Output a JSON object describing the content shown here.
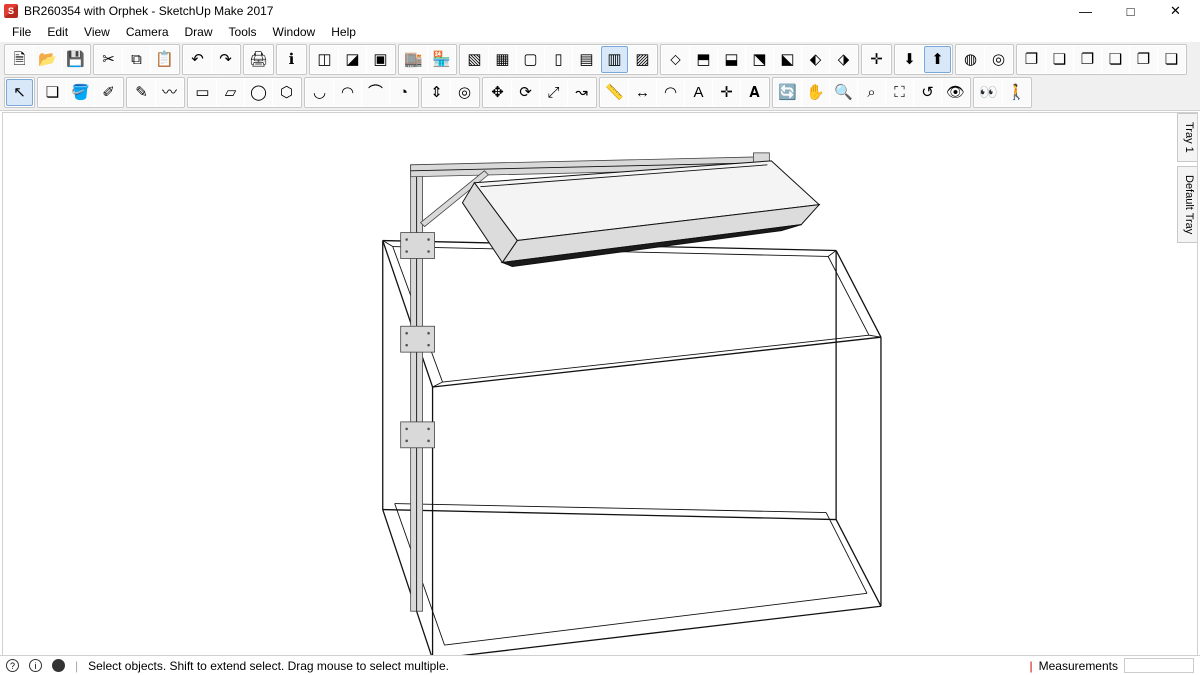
{
  "window": {
    "title": "BR260354 with Orphek - SketchUp Make 2017",
    "controls": {
      "min": "—",
      "max": "□",
      "close": "✕"
    }
  },
  "menu": [
    "File",
    "Edit",
    "View",
    "Camera",
    "Draw",
    "Tools",
    "Window",
    "Help"
  ],
  "trays": [
    "Tray 1",
    "Default Tray"
  ],
  "status": {
    "hint": "Select objects. Shift to extend select. Drag mouse to select multiple.",
    "measurements_label": "Measurements"
  },
  "toolbars": {
    "row1": [
      {
        "n": "new-icon",
        "g": "🗎"
      },
      {
        "n": "open-icon",
        "g": "📂"
      },
      {
        "n": "save-icon",
        "g": "💾"
      },
      null,
      {
        "n": "cut-icon",
        "g": "✂"
      },
      {
        "n": "copy-icon",
        "g": "⧉"
      },
      {
        "n": "paste-icon",
        "g": "📋"
      },
      null,
      {
        "n": "undo-icon",
        "g": "↶"
      },
      {
        "n": "redo-icon",
        "g": "↷"
      },
      null,
      {
        "n": "print-icon",
        "g": "🖨"
      },
      null,
      {
        "n": "model-info-icon",
        "g": "ℹ"
      },
      null,
      {
        "n": "style-a-icon",
        "g": "◫"
      },
      {
        "n": "style-b-icon",
        "g": "◪"
      },
      {
        "n": "style-c-icon",
        "g": "▣"
      },
      null,
      {
        "n": "warehouse-icon",
        "g": "🏬"
      },
      {
        "n": "ext-warehouse-icon",
        "g": "🏪"
      },
      null,
      {
        "n": "shaded-icon",
        "g": "▧"
      },
      {
        "n": "shaded-tex-icon",
        "g": "▦"
      },
      {
        "n": "hidden-line-icon",
        "g": "▢"
      },
      {
        "n": "wire-icon",
        "g": "▯"
      },
      {
        "n": "mono-icon",
        "g": "▤"
      },
      {
        "n": "xray-icon",
        "g": "▥",
        "active": true
      },
      {
        "n": "back-edges-icon",
        "g": "▨"
      },
      null,
      {
        "n": "iso-icon",
        "g": "⬦"
      },
      {
        "n": "top-icon",
        "g": "⬒"
      },
      {
        "n": "front-icon",
        "g": "⬓"
      },
      {
        "n": "right-icon",
        "g": "⬔"
      },
      {
        "n": "back-icon",
        "g": "⬕"
      },
      {
        "n": "left-icon",
        "g": "⬖"
      },
      {
        "n": "bottom-icon",
        "g": "⬗"
      },
      null,
      {
        "n": "axes-icon",
        "g": "✛"
      },
      null,
      {
        "n": "3dw-get-icon",
        "g": "⬇"
      },
      {
        "n": "3dw-share-icon",
        "g": "⬆",
        "active": true
      },
      null,
      {
        "n": "solid-a-icon",
        "g": "◍"
      },
      {
        "n": "solid-b-icon",
        "g": "◎"
      },
      null,
      {
        "n": "outer-shell-icon",
        "g": "❐"
      },
      {
        "n": "intersect-icon",
        "g": "❏"
      },
      {
        "n": "union-icon",
        "g": "❐"
      },
      {
        "n": "subtract-icon",
        "g": "❏"
      },
      {
        "n": "trim-icon",
        "g": "❐"
      },
      {
        "n": "split-icon",
        "g": "❏"
      }
    ],
    "row2": [
      {
        "n": "select-icon",
        "g": "↖",
        "active": true
      },
      null,
      {
        "n": "make-comp-icon",
        "g": "❏"
      },
      {
        "n": "paint-icon",
        "g": "🪣"
      },
      {
        "n": "eraser-icon",
        "g": "✐"
      },
      null,
      {
        "n": "pencil-icon",
        "g": "✎"
      },
      {
        "n": "freehand-icon",
        "g": "〰"
      },
      null,
      {
        "n": "rect-icon",
        "g": "▭"
      },
      {
        "n": "rot-rect-icon",
        "g": "▱"
      },
      {
        "n": "circle-icon",
        "g": "◯"
      },
      {
        "n": "poly-icon",
        "g": "⬡"
      },
      null,
      {
        "n": "arc-icon",
        "g": "◡"
      },
      {
        "n": "arc2-icon",
        "g": "◠"
      },
      {
        "n": "arc3-icon",
        "g": "⌒"
      },
      {
        "n": "pie-icon",
        "g": "◔"
      },
      null,
      {
        "n": "pushpull-icon",
        "g": "⇕"
      },
      {
        "n": "offset-icon",
        "g": "◎"
      },
      null,
      {
        "n": "move-icon",
        "g": "✥"
      },
      {
        "n": "rotate-icon",
        "g": "⟳"
      },
      {
        "n": "scale-icon",
        "g": "⤢"
      },
      {
        "n": "followme-icon",
        "g": "↝"
      },
      null,
      {
        "n": "tape-icon",
        "g": "📏"
      },
      {
        "n": "dim-icon",
        "g": "↔"
      },
      {
        "n": "protractor-icon",
        "g": "◠"
      },
      {
        "n": "text-icon",
        "g": "A"
      },
      {
        "n": "axes-tool-icon",
        "g": "✛"
      },
      {
        "n": "3dtext-icon",
        "g": "𝐀"
      },
      null,
      {
        "n": "orbit-icon",
        "g": "🔄"
      },
      {
        "n": "pan-icon",
        "g": "✋"
      },
      {
        "n": "zoom-icon",
        "g": "🔍"
      },
      {
        "n": "zoom-win-icon",
        "g": "⌕"
      },
      {
        "n": "zoom-ext-icon",
        "g": "⛶"
      },
      {
        "n": "prev-view-icon",
        "g": "↺"
      },
      {
        "n": "position-cam-icon",
        "g": "👁"
      },
      null,
      {
        "n": "look-icon",
        "g": "👀"
      },
      {
        "n": "walk-icon",
        "g": "🚶"
      }
    ]
  }
}
